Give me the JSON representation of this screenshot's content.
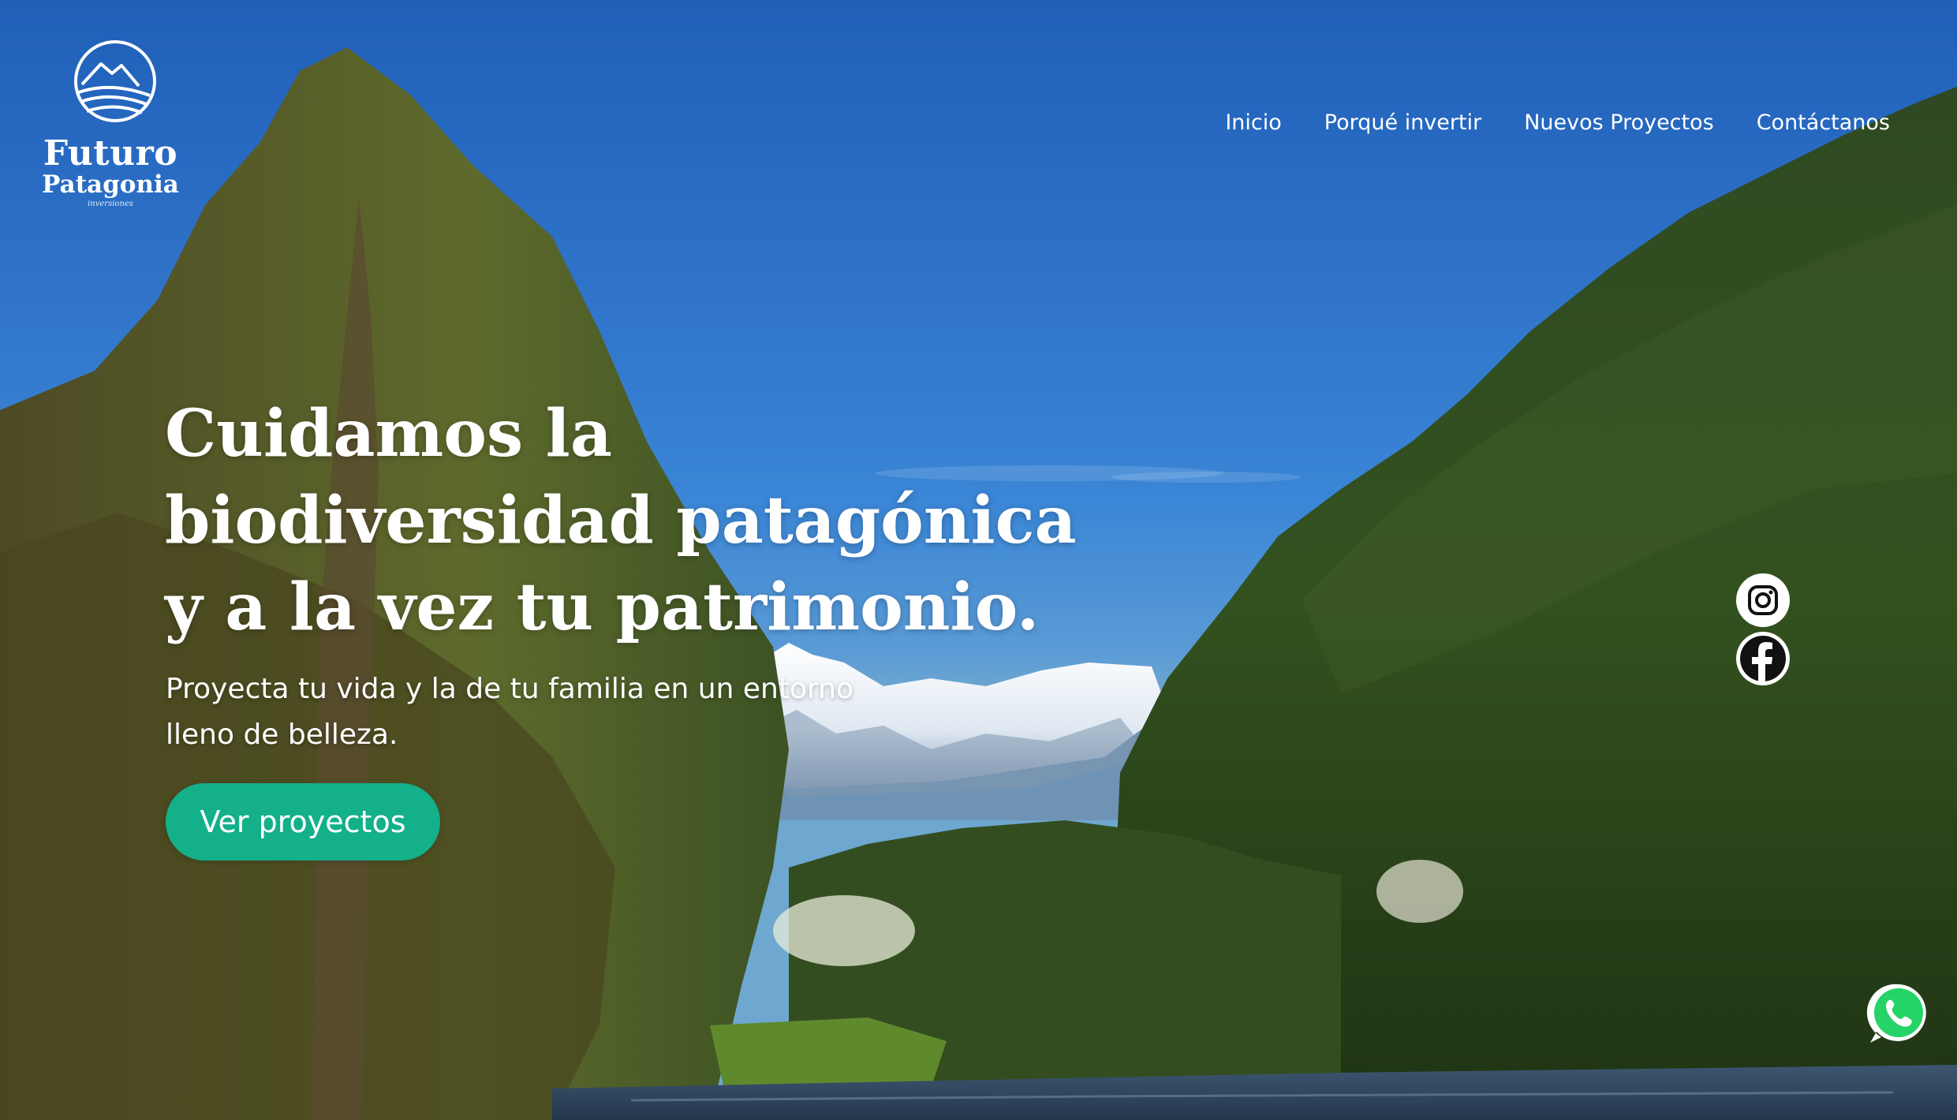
{
  "brand": {
    "name_line1": "Futuro",
    "name_line2": "Patagonia",
    "tagline": "inversiones"
  },
  "nav": {
    "items": [
      {
        "label": "Inicio"
      },
      {
        "label": "Porqué invertir"
      },
      {
        "label": "Nuevos Proyectos"
      },
      {
        "label": "Contáctanos"
      }
    ]
  },
  "hero": {
    "headline": [
      "Cuidamos la",
      "biodiversidad patagónica",
      "y a la vez tu patrimonio."
    ],
    "subtext": [
      "Proyecta tu vida y la de tu familia en un entorno",
      "lleno de belleza."
    ],
    "cta_label": "Ver proyectos"
  },
  "social": {
    "icons": [
      "instagram-icon",
      "facebook-icon",
      "whatsapp-icon"
    ]
  },
  "colors": {
    "accent": "#13b08a",
    "sky_top": "#1f5fb8",
    "forest": "#2e4a1f",
    "whatsapp_green": "#25d366"
  }
}
